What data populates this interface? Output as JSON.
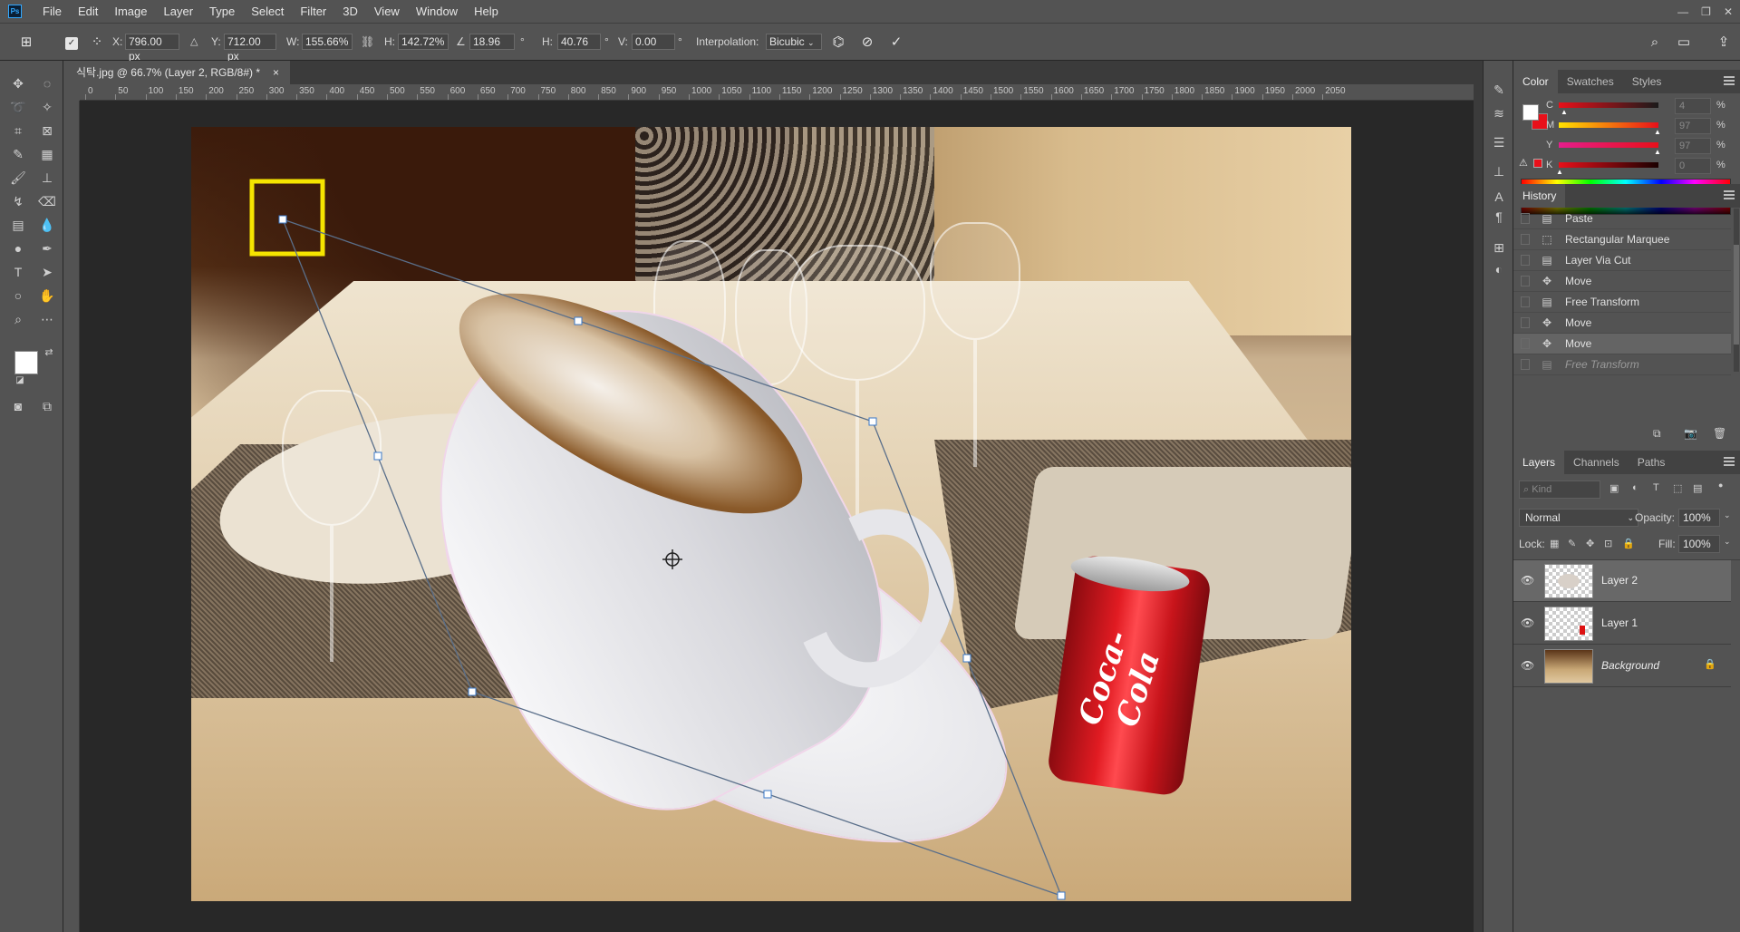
{
  "menu": {
    "logo": "Ps",
    "items": [
      "File",
      "Edit",
      "Image",
      "Layer",
      "Type",
      "Select",
      "Filter",
      "3D",
      "View",
      "Window",
      "Help"
    ]
  },
  "options": {
    "x_label": "X:",
    "x_value": "796.00 px",
    "y_label": "Y:",
    "y_value": "712.00 px",
    "w_label": "W:",
    "w_value": "155.66%",
    "h_label": "H:",
    "h_value": "142.72%",
    "angle_value": "18.96",
    "deg": "°",
    "hskew_label": "H:",
    "hskew_value": "40.76",
    "vskew_label": "V:",
    "vskew_value": "0.00",
    "interp_label": "Interpolation:",
    "interp_value": "Bicubic"
  },
  "document": {
    "tab_title": "식탁.jpg @ 66.7% (Layer 2, RGB/8#) *",
    "close": "×"
  },
  "ruler": {
    "labels": [
      "0",
      "50",
      "100",
      "150",
      "200",
      "250",
      "300",
      "350",
      "400",
      "450",
      "500",
      "550",
      "600",
      "650",
      "700",
      "750",
      "800",
      "850",
      "900",
      "950",
      "1000",
      "1050",
      "1100",
      "1150",
      "1200",
      "1250",
      "1300",
      "1350",
      "1400",
      "1450",
      "1500",
      "1550",
      "1600",
      "1650",
      "1700",
      "1750",
      "1800",
      "1850",
      "1900",
      "1950",
      "2000",
      "2050"
    ]
  },
  "image_text": {
    "can_logo": "Coca-Cola"
  },
  "color_panel": {
    "tabs": [
      "Color",
      "Swatches",
      "Styles"
    ],
    "sliders": [
      {
        "letter": "C",
        "value": "4",
        "pct": "%"
      },
      {
        "letter": "M",
        "value": "97",
        "pct": "%"
      },
      {
        "letter": "Y",
        "value": "97",
        "pct": "%"
      },
      {
        "letter": "K",
        "value": "0",
        "pct": "%"
      }
    ]
  },
  "history_panel": {
    "title": "History",
    "items": [
      {
        "label": "Paste",
        "icon": "document-icon"
      },
      {
        "label": "Rectangular Marquee",
        "icon": "marquee-icon"
      },
      {
        "label": "Layer Via Cut",
        "icon": "document-icon"
      },
      {
        "label": "Move",
        "icon": "move-icon"
      },
      {
        "label": "Free Transform",
        "icon": "document-icon"
      },
      {
        "label": "Move",
        "icon": "move-icon"
      },
      {
        "label": "Move",
        "icon": "move-icon"
      },
      {
        "label": "Free Transform",
        "icon": "document-icon"
      }
    ]
  },
  "layers_panel": {
    "tabs": [
      "Layers",
      "Channels",
      "Paths"
    ],
    "kind_placeholder": "Kind",
    "blend_mode": "Normal",
    "opacity_label": "Opacity:",
    "opacity_value": "100%",
    "lock_label": "Lock:",
    "fill_label": "Fill:",
    "fill_value": "100%",
    "layers": [
      {
        "name": "Layer 2"
      },
      {
        "name": "Layer 1"
      },
      {
        "name": "Background"
      }
    ]
  }
}
